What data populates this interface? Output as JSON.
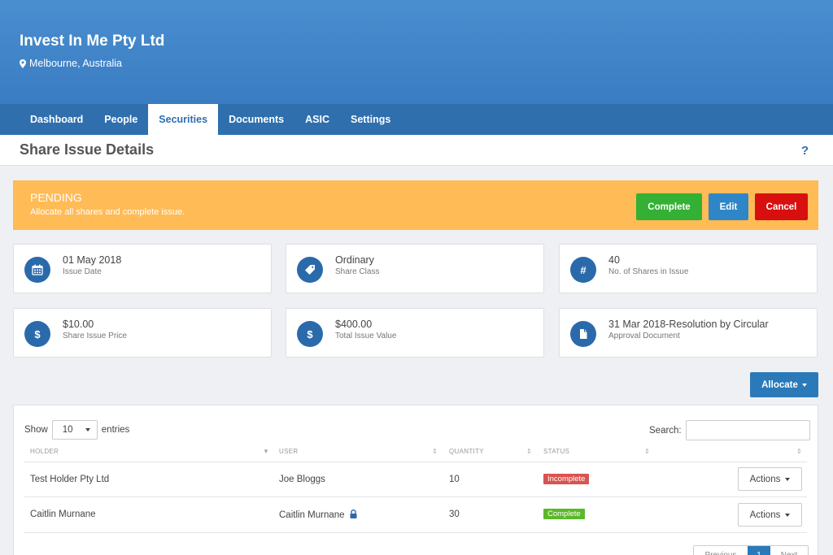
{
  "header": {
    "company": "Invest In Me Pty Ltd",
    "location": "Melbourne, Australia"
  },
  "nav": {
    "tabs": [
      "Dashboard",
      "People",
      "Securities",
      "Documents",
      "ASIC",
      "Settings"
    ],
    "active": "Securities"
  },
  "page": {
    "title": "Share Issue Details",
    "help": "?"
  },
  "banner": {
    "status": "PENDING",
    "message": "Allocate all shares and complete issue.",
    "complete_label": "Complete",
    "edit_label": "Edit",
    "cancel_label": "Cancel"
  },
  "cards": [
    {
      "value": "01 May 2018",
      "label": "Issue Date",
      "icon": "calendar-icon"
    },
    {
      "value": "Ordinary",
      "label": "Share Class",
      "icon": "tag-icon"
    },
    {
      "value": "40",
      "label": "No. of Shares in Issue",
      "icon": "hash-icon"
    },
    {
      "value": "$10.00",
      "label": "Share Issue Price",
      "icon": "dollar-icon"
    },
    {
      "value": "$400.00",
      "label": "Total Issue Value",
      "icon": "dollar-icon"
    },
    {
      "value": "31 Mar 2018-Resolution by Circular",
      "label": "Approval Document",
      "icon": "document-icon"
    }
  ],
  "allocate_label": "Allocate",
  "table": {
    "show_label": "Show",
    "entries_label": "entries",
    "page_size": "10",
    "search_label": "Search:",
    "columns": [
      "HOLDER",
      "USER",
      "QUANTITY",
      "STATUS"
    ],
    "rows": [
      {
        "holder": "Test Holder Pty Ltd",
        "user": "Joe Bloggs",
        "quantity": "10",
        "status": "Incomplete",
        "locked": false
      },
      {
        "holder": "Caitlin Murnane",
        "user": "Caitlin Murnane",
        "quantity": "30",
        "status": "Complete",
        "locked": true
      }
    ],
    "actions_label": "Actions",
    "pager": {
      "prev": "Previous",
      "current": "1",
      "next": "Next"
    }
  },
  "colors": {
    "header": "#3a7cc2",
    "nav": "#2f6fae",
    "banner": "#ffbb55",
    "complete": "#34b034",
    "edit": "#2e86c6",
    "cancel": "#d80f0f"
  }
}
